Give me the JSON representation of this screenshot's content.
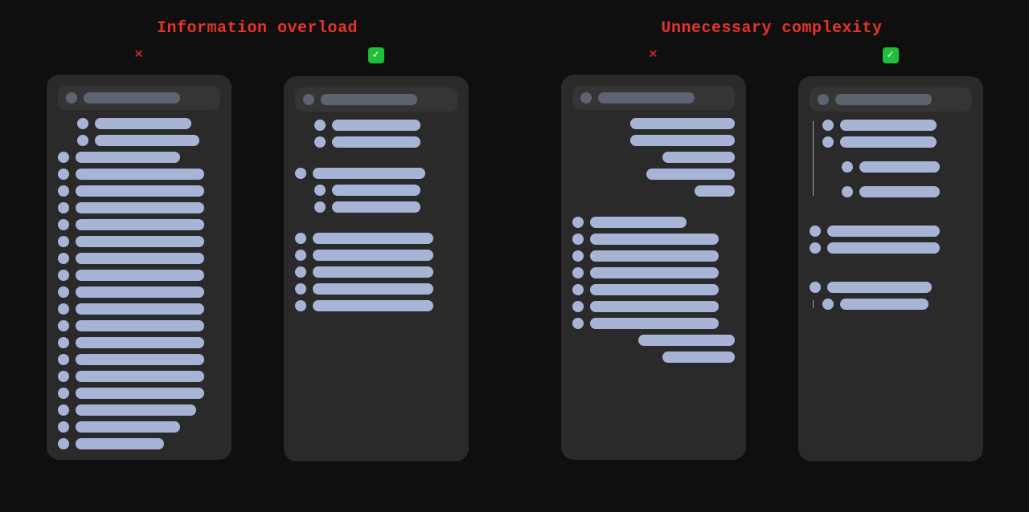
{
  "sections": [
    {
      "title": "Information overload"
    },
    {
      "title": "Unnecessary complexity"
    }
  ],
  "badges": {
    "cross": "✕",
    "check": "✓"
  }
}
